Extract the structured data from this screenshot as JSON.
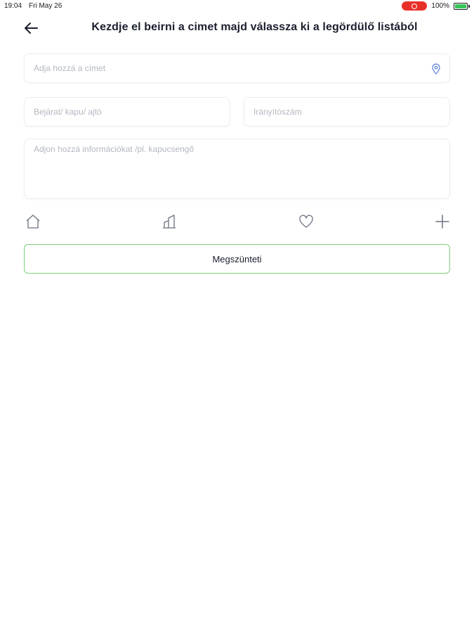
{
  "status_bar": {
    "time": "19:04",
    "date": "Fri May 26",
    "battery": "100%",
    "record_color": "#e8302a",
    "battery_color": "#35c759"
  },
  "header": {
    "back_icon": "arrow-left-icon",
    "title": "Kezdje el beirni a cimet majd válassza ki a legördülő listából"
  },
  "form": {
    "address": {
      "value": "",
      "placeholder": "Adja hozzá a címet",
      "icon": "location-pin-icon"
    },
    "entrance": {
      "value": "",
      "placeholder": "Bejárat/ kapu/ ajtó"
    },
    "zip": {
      "value": "",
      "placeholder": "Irányítószám"
    },
    "info": {
      "value": "",
      "placeholder": "Adjon hozzá információkat /pl. kapucsengő"
    }
  },
  "address_types": [
    {
      "icon": "home-icon"
    },
    {
      "icon": "building-icon"
    },
    {
      "icon": "heart-icon"
    },
    {
      "icon": "plus-icon"
    }
  ],
  "actions": {
    "cancel_label": "Megszünteti",
    "cancel_border_color": "#7ed07a"
  },
  "colors": {
    "accent_pin": "#5b7fd6",
    "icon_stroke": "#6b7280"
  }
}
